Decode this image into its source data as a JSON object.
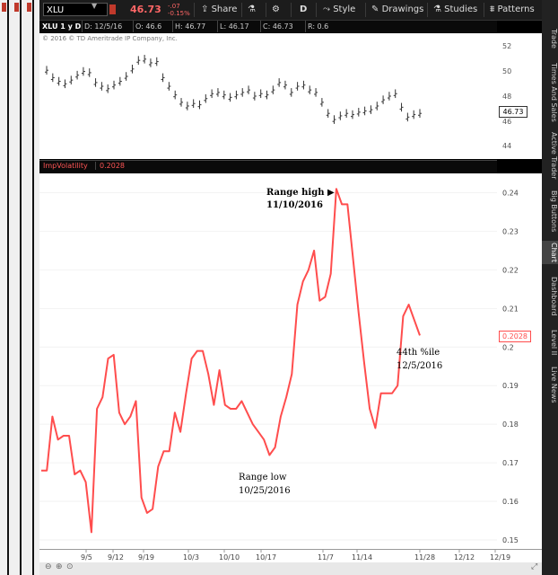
{
  "toolbar": {
    "symbol": "XLU",
    "price": "46.73",
    "change": "-.07",
    "change_pct": "-0.15%",
    "share_label": "Share",
    "period_label": "D",
    "style_label": "Style",
    "drawings_label": "Drawings",
    "studies_label": "Studies",
    "patterns_label": "Patterns"
  },
  "info_bar": {
    "title": "XLU 1 y D",
    "date": "D: 12/5/16",
    "open": "O: 46.6",
    "high": "H: 46.77",
    "low": "L: 46.17",
    "close": "C: 46.73",
    "r": "R: 0.6"
  },
  "price_panel": {
    "copyright": "© 2016 © TD Ameritrade IP Company, Inc.",
    "y_ticks": [
      "52",
      "50",
      "48",
      "46",
      "44"
    ],
    "last_price_label": "46.73"
  },
  "indicator_panel": {
    "name": "ImpVolatility",
    "value": "0.2028",
    "y_ticks": [
      "0.24",
      "0.23",
      "0.22",
      "0.21",
      "0.2",
      "0.19",
      "0.18",
      "0.17",
      "0.16",
      "0.15"
    ],
    "last_value_label": "0.2028",
    "line_color": "#ff4d4d"
  },
  "x_axis": {
    "ticks": [
      "9/5",
      "9/12",
      "9/19",
      "10/3",
      "10/10",
      "10/17",
      "11/7",
      "11/14",
      "11/28",
      "12/12",
      "12/19"
    ]
  },
  "annotations": {
    "range_high_1": "Range high",
    "range_high_2": "11/10/2016",
    "range_low_1": "Range low",
    "range_low_2": "10/25/2016",
    "pct_1": "44th %ile",
    "pct_2": "12/5/2016"
  },
  "right_tabs": [
    "Trade",
    "Times And Sales",
    "Active Trader",
    "Big Buttons",
    "Chart",
    "Dashboard",
    "Level II",
    "Live News"
  ],
  "chart_data": {
    "type": "line",
    "series": [
      {
        "values": [
          0.168,
          0.168,
          0.182,
          0.176,
          0.177,
          0.177,
          0.167,
          0.168,
          0.165,
          0.152,
          0.184,
          0.187,
          0.197,
          0.198,
          0.183,
          0.18,
          0.182,
          0.186,
          0.161,
          0.157,
          0.158,
          0.169,
          0.173,
          0.173,
          0.183,
          0.178,
          0.188,
          0.197,
          0.199,
          0.199,
          0.193,
          0.185,
          0.194,
          0.185,
          0.184,
          0.184,
          0.186,
          0.183,
          0.18,
          0.178,
          0.176,
          0.172,
          0.174,
          0.182,
          0.187,
          0.193,
          0.211,
          0.217,
          0.22,
          0.225,
          0.212,
          0.213,
          0.219,
          0.241,
          0.237,
          0.237,
          0.223,
          0.209,
          0.196,
          0.184,
          0.179,
          0.188,
          0.188,
          0.188,
          0.19,
          0.208,
          0.211,
          0.207,
          0.203
        ]
      }
    ],
    "ylim": [
      0.15,
      0.245
    ]
  }
}
